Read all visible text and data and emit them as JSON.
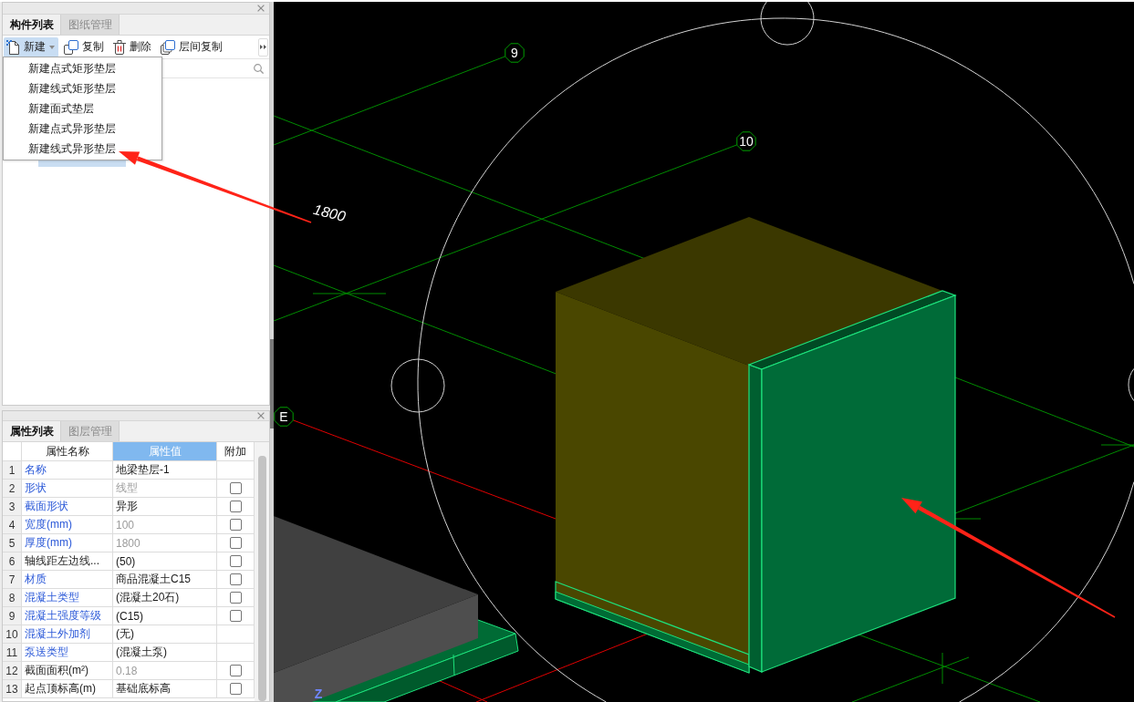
{
  "component_panel": {
    "tabs": [
      {
        "label": "构件列表",
        "selected": true
      },
      {
        "label": "图纸管理",
        "selected": false
      }
    ],
    "toolbar": [
      {
        "kind": "new",
        "label": "新建",
        "dropdown": true,
        "open": true
      },
      {
        "kind": "copy",
        "label": "复制",
        "dropdown": false,
        "open": false
      },
      {
        "kind": "delete",
        "label": "删除",
        "dropdown": false,
        "open": false
      },
      {
        "kind": "floor_copy",
        "label": "层间复制",
        "dropdown": false,
        "open": false
      }
    ],
    "new_menu": [
      "新建点式矩形垫层",
      "新建线式矩形垫层",
      "新建面式垫层",
      "新建点式异形垫层",
      "新建线式异形垫层"
    ],
    "list": [
      {
        "selected": true
      }
    ]
  },
  "property_panel": {
    "tabs": [
      {
        "label": "属性列表",
        "selected": true
      },
      {
        "label": "图层管理",
        "selected": false
      }
    ],
    "columns": [
      {
        "label": "属性名称",
        "selected": false
      },
      {
        "label": "属性值",
        "selected": true
      },
      {
        "label": "附加",
        "selected": false
      }
    ],
    "rows": [
      {
        "index": "1",
        "name": "名称",
        "public": true,
        "value": "地梁垫层-1",
        "readonly": false
      },
      {
        "index": "2",
        "name": "形状",
        "public": true,
        "value": "线型",
        "readonly": true,
        "checked": false
      },
      {
        "index": "3",
        "name": "截面形状",
        "public": true,
        "value": "异形",
        "readonly": false,
        "checked": false
      },
      {
        "index": "4",
        "name": "宽度(mm)",
        "public": true,
        "value": "100",
        "readonly": true,
        "checked": false
      },
      {
        "index": "5",
        "name": "厚度(mm)",
        "public": true,
        "value": "1800",
        "readonly": true,
        "checked": false
      },
      {
        "index": "6",
        "name": "轴线距左边线...",
        "public": false,
        "value": "(50)",
        "readonly": false,
        "checked": false
      },
      {
        "index": "7",
        "name": "材质",
        "public": true,
        "value": "商品混凝土C15",
        "readonly": false,
        "checked": false
      },
      {
        "index": "8",
        "name": "混凝土类型",
        "public": true,
        "value": "(混凝土20石)",
        "readonly": false,
        "checked": false
      },
      {
        "index": "9",
        "name": "混凝土强度等级",
        "public": true,
        "value": "(C15)",
        "readonly": false,
        "checked": false
      },
      {
        "index": "10",
        "name": "混凝土外加剂",
        "public": true,
        "value": "(无)",
        "readonly": false
      },
      {
        "index": "11",
        "name": "泵送类型",
        "public": true,
        "value": "(混凝土泵)",
        "readonly": false
      },
      {
        "index": "12",
        "name": "截面面积(m²)",
        "public": false,
        "value": "0.18",
        "readonly": true,
        "checked": false
      },
      {
        "index": "13",
        "name": "起点顶标高(m)",
        "public": false,
        "value": "基础底标高",
        "readonly": false,
        "checked": false
      }
    ]
  },
  "viewport": {
    "axis_labels": [
      {
        "text": "9"
      },
      {
        "text": "10"
      },
      {
        "text": "E"
      }
    ],
    "dimension_label": "1800",
    "axis_indicator": "Z"
  }
}
